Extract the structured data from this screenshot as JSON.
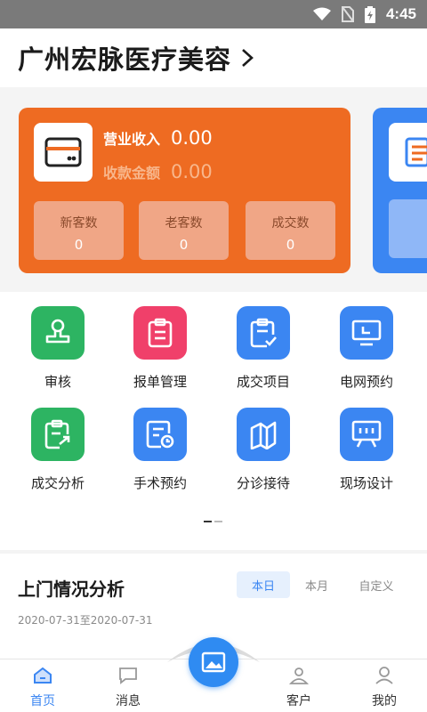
{
  "status_bar": {
    "time": "4:45",
    "icons": [
      "wifi-icon",
      "no-sim-icon",
      "battery-charging-icon"
    ]
  },
  "header": {
    "title": "广州宏脉医疗美容",
    "chevron": "chevron-right-icon"
  },
  "cards": {
    "orange": {
      "icon": "bank-card-icon",
      "revenue_label": "营业收入",
      "revenue_value": "0.00",
      "collection_label": "收款金额",
      "collection_value": "0.00",
      "stats": [
        {
          "label": "新客数",
          "value": "0"
        },
        {
          "label": "老客数",
          "value": "0"
        },
        {
          "label": "成交数",
          "value": "0"
        }
      ]
    },
    "blue": {
      "icon": "document-list-icon"
    }
  },
  "grid": [
    {
      "label": "审核",
      "icon": "stamp-icon",
      "color": "#2db462"
    },
    {
      "label": "报单管理",
      "icon": "clipboard-icon",
      "color": "#f0406a"
    },
    {
      "label": "成交项目",
      "icon": "clipboard-check-icon",
      "color": "#3b86f2"
    },
    {
      "label": "电网预约",
      "icon": "monitor-icon",
      "color": "#3b86f2"
    },
    {
      "label": "成交分析",
      "icon": "clipboard-arrow-icon",
      "color": "#2db462"
    },
    {
      "label": "手术预约",
      "icon": "schedule-clock-icon",
      "color": "#3b86f2"
    },
    {
      "label": "分诊接待",
      "icon": "map-fold-icon",
      "color": "#3b86f2"
    },
    {
      "label": "现场设计",
      "icon": "easel-board-icon",
      "color": "#3b86f2"
    }
  ],
  "analysis": {
    "title": "上门情况分析",
    "segments": [
      {
        "label": "本日",
        "active": true
      },
      {
        "label": "本月",
        "active": false
      },
      {
        "label": "自定义",
        "active": false
      }
    ],
    "date_range": "2020-07-31至2020-07-31"
  },
  "tabbar": [
    {
      "label": "首页",
      "icon": "home-icon",
      "active": true
    },
    {
      "label": "消息",
      "icon": "message-icon",
      "active": false
    },
    {
      "label": "客户",
      "icon": "customer-icon",
      "active": false
    },
    {
      "label": "我的",
      "icon": "profile-icon",
      "active": false
    }
  ],
  "center_button": {
    "icon": "image-icon"
  },
  "colors": {
    "accent": "#3b86f2",
    "orange_card": "#ee6b22",
    "green": "#2db462",
    "red": "#f0406a"
  }
}
